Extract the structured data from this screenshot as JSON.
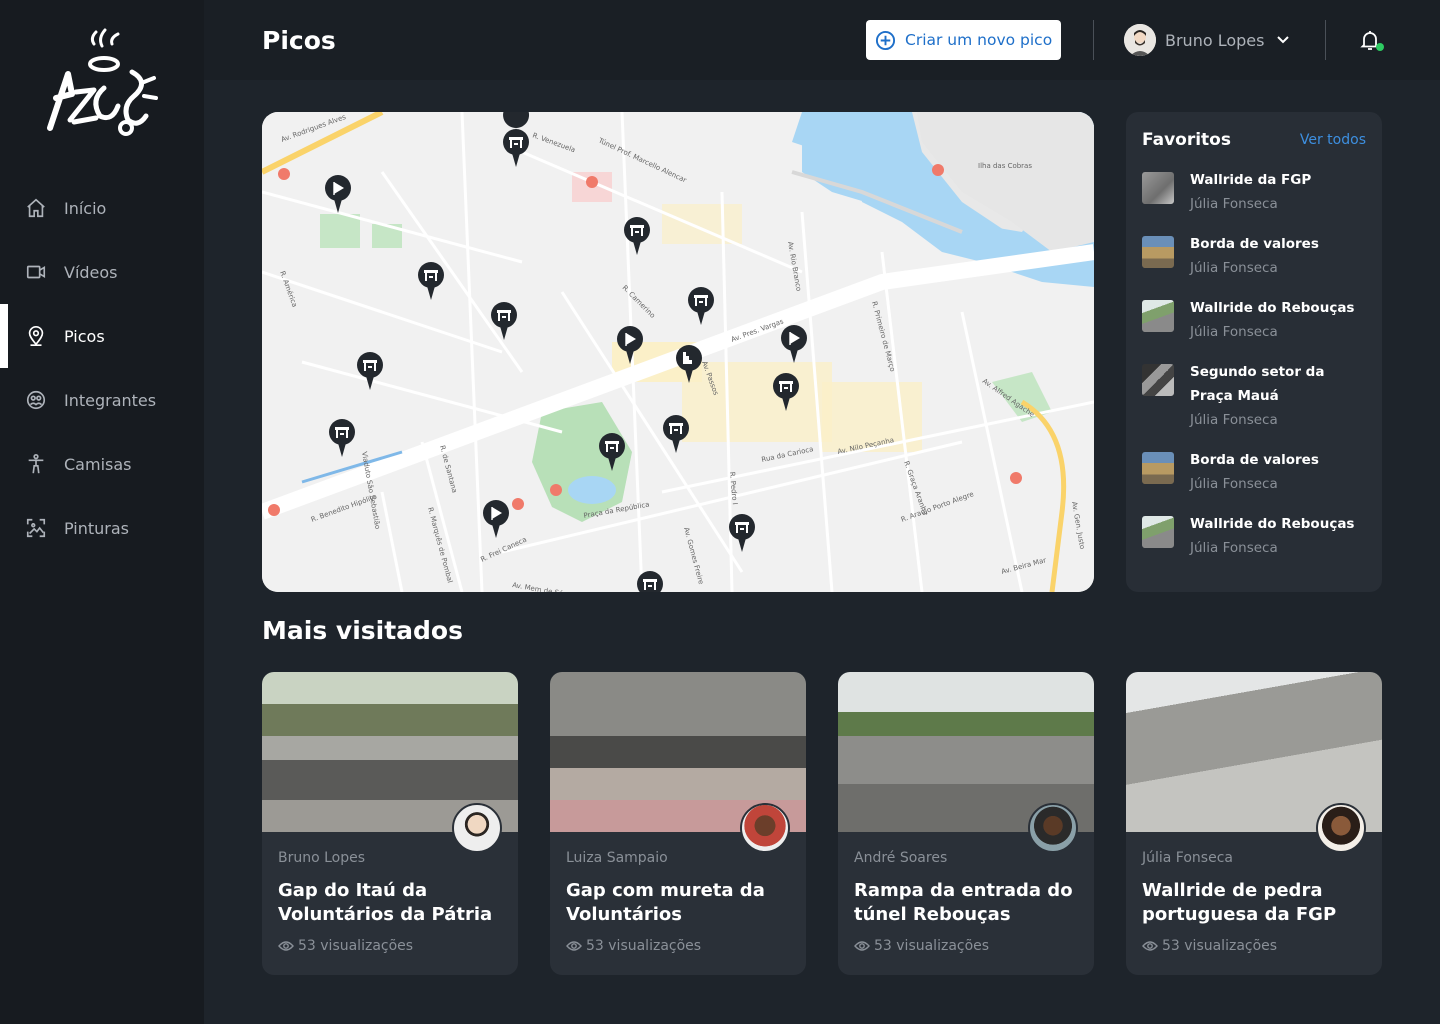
{
  "app": {
    "logo": "AZOS"
  },
  "sidebar": {
    "items": [
      {
        "label": "Início",
        "icon": "home-icon"
      },
      {
        "label": "Vídeos",
        "icon": "video-icon"
      },
      {
        "label": "Picos",
        "icon": "map-pin-icon",
        "active": true
      },
      {
        "label": "Integrantes",
        "icon": "people-icon"
      },
      {
        "label": "Camisas",
        "icon": "person-icon"
      },
      {
        "label": "Pinturas",
        "icon": "image-icon"
      }
    ]
  },
  "header": {
    "title": "Picos",
    "new_button": "Criar um novo pico",
    "user_name": "Bruno Lopes"
  },
  "map": {
    "labels": [
      "Av. Rodrigues Alves",
      "R. Venezuela",
      "Túnel Prof. Marcello Alencar",
      "Ilha das Cobras",
      "Av. Rio Branco",
      "Av. Pres. Vargas",
      "R. Camerino",
      "R. Primeiro de Março",
      "Av. Alfred Agache",
      "Av. Passos",
      "R. Buenos Aires",
      "Rua da Carioca",
      "Av. Nilo Peçanha",
      "R. Graça Aranha",
      "R. Araújo Porto Alegre",
      "Av. Gen. Justo",
      "Av. Beira Mar",
      "R. Frei Caneca",
      "Av. Mem de Sá",
      "R. Henrique Valadares",
      "Praça da República",
      "R. Benedito Hipólito",
      "Viaduto São Sebastião",
      "R. Marquês de Pombal",
      "R. de Santana",
      "R. Pedro I",
      "Av. Gomes Freire",
      "R. Camerino",
      "R. América"
    ]
  },
  "favorites": {
    "title": "Favoritos",
    "see_all": "Ver todos",
    "items": [
      {
        "name": "Wallride da FGP",
        "author": "Júlia Fonseca"
      },
      {
        "name": "Borda de valores",
        "author": "Júlia Fonseca"
      },
      {
        "name": "Wallride do Rebouças",
        "author": "Júlia Fonseca"
      },
      {
        "name": "Segundo setor da Praça Mauá",
        "author": "Júlia Fonseca"
      },
      {
        "name": "Borda de valores",
        "author": "Júlia Fonseca"
      },
      {
        "name": "Wallride do Rebouças",
        "author": "Júlia Fonseca"
      }
    ]
  },
  "most_visited": {
    "title": "Mais visitados",
    "cards": [
      {
        "author": "Bruno Lopes",
        "title": "Gap do Itaú da Voluntários da Pátria",
        "views": "53 visualizações"
      },
      {
        "author": "Luiza Sampaio",
        "title": "Gap com mureta da Voluntários",
        "views": "53 visualizações"
      },
      {
        "author": "André Soares",
        "title": "Rampa da entrada do túnel Rebouças",
        "views": "53 visualizações"
      },
      {
        "author": "Júlia Fonseca",
        "title": "Wallride de pedra portuguesa da FGP",
        "views": "53 visualizações"
      }
    ]
  },
  "colors": {
    "accent": "#1e6fc9",
    "link": "#3d8fe0",
    "online": "#2dcb62",
    "sidebar_bg": "#171b20",
    "page_bg": "#1e242b",
    "card_bg": "#2a3038"
  }
}
